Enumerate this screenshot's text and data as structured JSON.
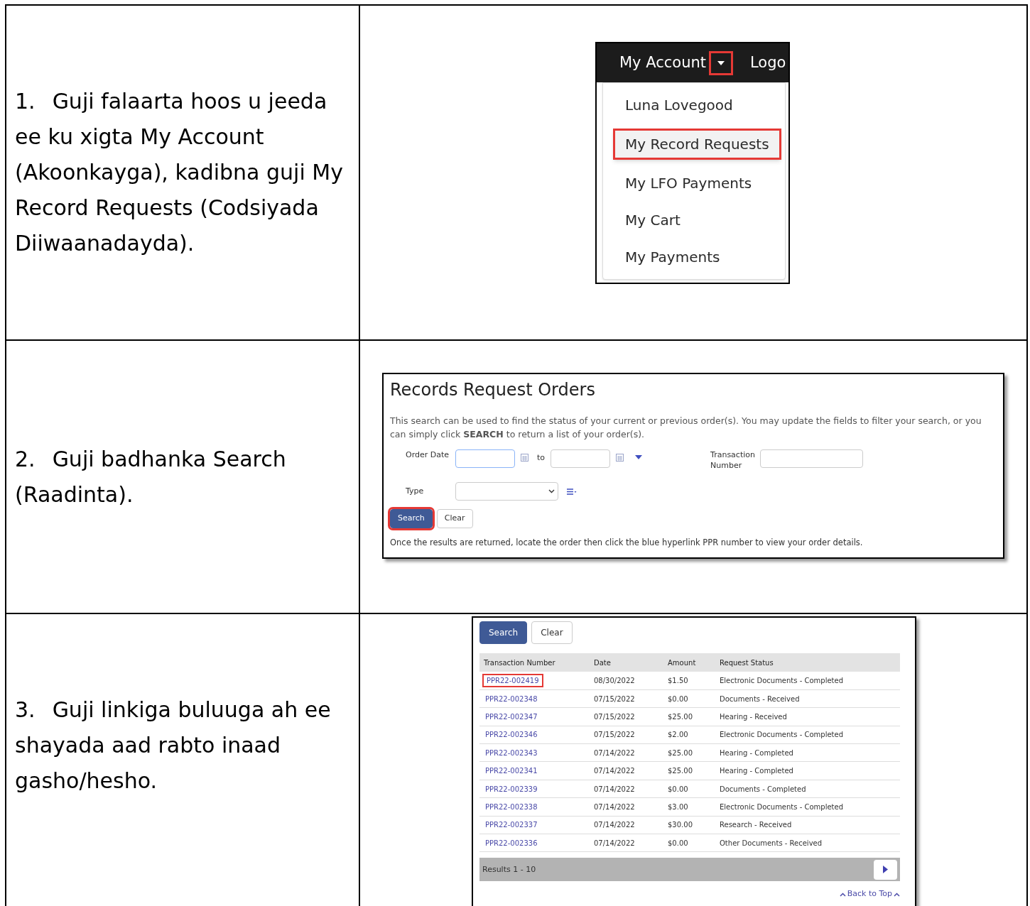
{
  "steps": [
    {
      "number": "1.",
      "text": "Guji falaarta hoos u jeeda ee ku xigta My Account (Akoonkayga), kadibna guji My Record Requests (Codsiyada Diiwaanadayda).",
      "screenshot": {
        "kind": "account_menu",
        "nav_label": "My Account",
        "caret_highlighted": true,
        "nav_next": "Logo",
        "menu": [
          {
            "label": "Luna Lovegood",
            "highlighted": false
          },
          {
            "label": "My Record Requests",
            "highlighted": true
          },
          {
            "label": "My LFO Payments",
            "highlighted": false
          },
          {
            "label": "My Cart",
            "highlighted": false
          },
          {
            "label": "My Payments",
            "highlighted": false
          }
        ]
      }
    },
    {
      "number": "2.",
      "text": "Guji badhanka Search (Raadinta).",
      "screenshot": {
        "kind": "search_form",
        "title": "Records Request Orders",
        "intro": "This search can be used to find the status of your current or previous order(s). You may update the fields to filter your search, or you can simply click **SEARCH** to return a list of your order(s).",
        "order_date_label": "Order Date",
        "to_label": "to",
        "transaction_label": "Transaction Number",
        "type_label": "Type",
        "buttons": [
          {
            "label": "Search",
            "kind": "primary",
            "highlighted": true
          },
          {
            "label": "Clear",
            "kind": "secondary",
            "highlighted": false
          }
        ],
        "footer": "Once the results are returned, locate the order then click the blue hyperlink PPR number to view your order details."
      }
    },
    {
      "number": "3.",
      "text": "Guji linkiga buluuga ah ee shayada aad rabto inaad gasho/hesho.",
      "screenshot": {
        "kind": "results",
        "buttons": [
          {
            "label": "Search",
            "kind": "primary",
            "highlighted": false
          },
          {
            "label": "Clear",
            "kind": "secondary",
            "highlighted": false
          }
        ],
        "columns": [
          "Transaction Number",
          "Date",
          "Amount",
          "Request Status"
        ],
        "rows": [
          {
            "id": "PPR22-002419",
            "date": "08/30/2022",
            "amount": "$1.50",
            "status": "Electronic Documents - Completed",
            "highlighted": true
          },
          {
            "id": "PPR22-002348",
            "date": "07/15/2022",
            "amount": "$0.00",
            "status": "Documents - Received",
            "highlighted": false
          },
          {
            "id": "PPR22-002347",
            "date": "07/15/2022",
            "amount": "$25.00",
            "status": "Hearing - Received",
            "highlighted": false
          },
          {
            "id": "PPR22-002346",
            "date": "07/15/2022",
            "amount": "$2.00",
            "status": "Electronic Documents - Completed",
            "highlighted": false
          },
          {
            "id": "PPR22-002343",
            "date": "07/14/2022",
            "amount": "$25.00",
            "status": "Hearing - Completed",
            "highlighted": false
          },
          {
            "id": "PPR22-002341",
            "date": "07/14/2022",
            "amount": "$25.00",
            "status": "Hearing - Completed",
            "highlighted": false
          },
          {
            "id": "PPR22-002339",
            "date": "07/14/2022",
            "amount": "$0.00",
            "status": "Documents - Completed",
            "highlighted": false
          },
          {
            "id": "PPR22-002338",
            "date": "07/14/2022",
            "amount": "$3.00",
            "status": "Electronic Documents - Completed",
            "highlighted": false
          },
          {
            "id": "PPR22-002337",
            "date": "07/14/2022",
            "amount": "$30.00",
            "status": "Research - Received",
            "highlighted": false
          },
          {
            "id": "PPR22-002336",
            "date": "07/14/2022",
            "amount": "$0.00",
            "status": "Other Documents - Received",
            "highlighted": false
          }
        ],
        "results_label": "Results 1 - 10",
        "back_to_top": "Back to Top"
      }
    }
  ]
}
